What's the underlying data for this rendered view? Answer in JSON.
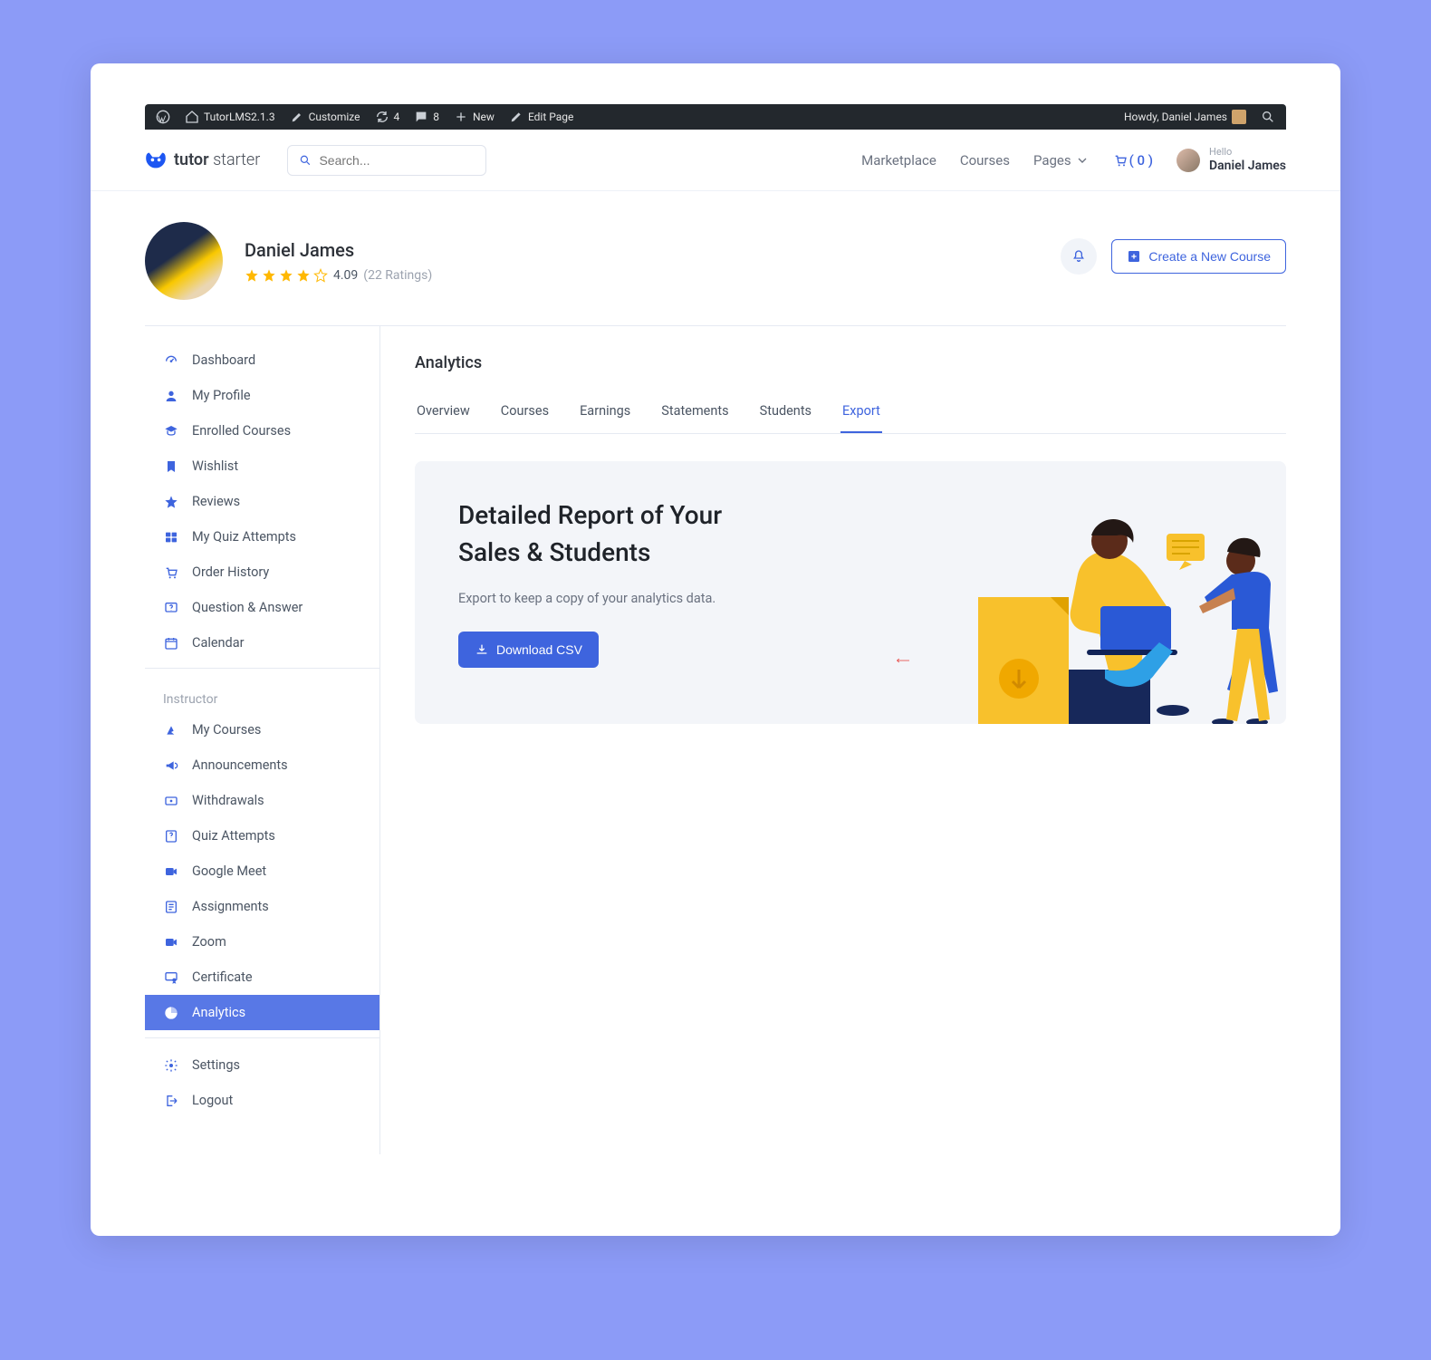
{
  "wpbar": {
    "site": "TutorLMS2.1.3",
    "customize": "Customize",
    "updates": "4",
    "comments": "8",
    "new": "New",
    "edit": "Edit Page",
    "howdy": "Howdy, Daniel James"
  },
  "topnav": {
    "brand_primary": "tutor",
    "brand_secondary": "starter",
    "search_placeholder": "Search...",
    "links": {
      "marketplace": "Marketplace",
      "courses": "Courses",
      "pages": "Pages"
    },
    "cart": "( 0 )",
    "hello": "Hello",
    "user_name": "Daniel James"
  },
  "profile": {
    "name": "Daniel James",
    "rating": "4.09",
    "rating_count": "(22 Ratings)",
    "create_button": "Create a New Course"
  },
  "sidebar": {
    "group1": [
      "Dashboard",
      "My Profile",
      "Enrolled Courses",
      "Wishlist",
      "Reviews",
      "My Quiz Attempts",
      "Order History",
      "Question & Answer",
      "Calendar"
    ],
    "instructor_label": "Instructor",
    "group2": [
      "My Courses",
      "Announcements",
      "Withdrawals",
      "Quiz Attempts",
      "Google Meet",
      "Assignments",
      "Zoom",
      "Certificate",
      "Analytics"
    ],
    "group3": [
      "Settings",
      "Logout"
    ],
    "active": "Analytics"
  },
  "main": {
    "title": "Analytics",
    "tabs": [
      "Overview",
      "Courses",
      "Earnings",
      "Statements",
      "Students",
      "Export"
    ],
    "active_tab": "Export",
    "card_title_l1": "Detailed Report of Your",
    "card_title_l2": "Sales & Students",
    "card_sub": "Export to keep a copy of your analytics data.",
    "download": "Download CSV"
  }
}
